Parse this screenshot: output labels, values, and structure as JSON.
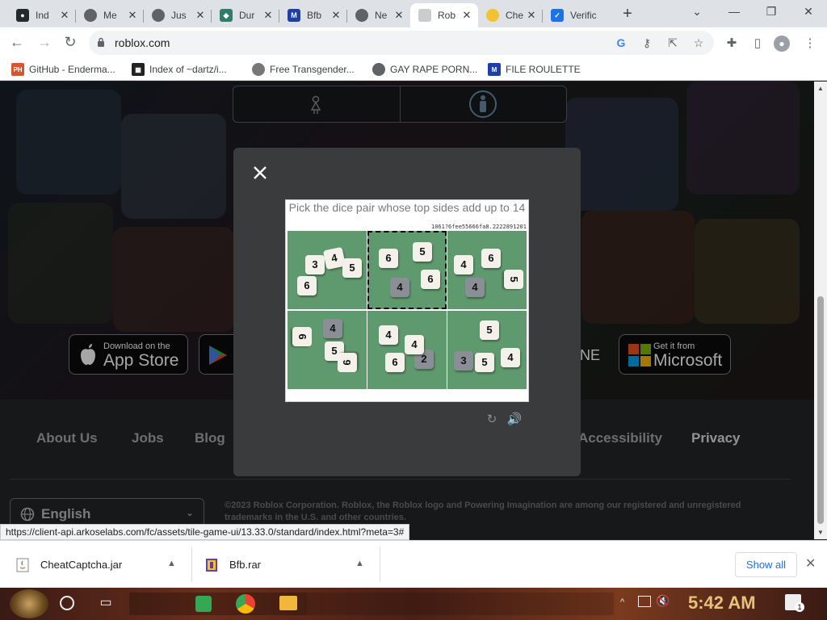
{
  "browser": {
    "tabs": [
      {
        "label": "Ind",
        "icon": "github-octocat-icon"
      },
      {
        "label": "Me",
        "icon": "chrome-icon"
      },
      {
        "label": "Jus",
        "icon": "chrome-icon"
      },
      {
        "label": "Dur",
        "icon": "cube-icon"
      },
      {
        "label": "Bfb",
        "icon": "mft-icon"
      },
      {
        "label": "Ne",
        "icon": "chrome-icon"
      },
      {
        "label": "Rob",
        "icon": "roblox-icon"
      },
      {
        "label": "Che",
        "icon": "banana-icon"
      },
      {
        "label": "Verific",
        "icon": "verification-icon"
      }
    ],
    "url": "roblox.com",
    "bookmarks": [
      {
        "label": "GitHub - Enderma...",
        "icon": "ph-icon"
      },
      {
        "label": "Index of ~dartz/i...",
        "icon": "pixel-icon"
      },
      {
        "label": "Free Transgender...",
        "icon": "mask-icon"
      },
      {
        "label": "GAY RAPE PORN...",
        "icon": "globe-icon"
      },
      {
        "label": "FILE ROULETTE",
        "icon": "mft-icon"
      }
    ]
  },
  "page": {
    "store_badges": [
      {
        "small": "Download on the",
        "big": "App Store"
      },
      {
        "small": "Get it from",
        "big": "Microsoft"
      }
    ],
    "store_partial_text": "NE",
    "footer_links": [
      "About Us",
      "Jobs",
      "Blog",
      "Accessibility",
      "Privacy"
    ],
    "language": "English",
    "copyright": "©2023 Roblox Corporation. Roblox, the Roblox logo and Powering Imagination are among our registered and unregistered trademarks in the U.S. and other countries."
  },
  "captcha": {
    "prompt": "Pick the dice pair whose top sides add up to 14",
    "meta": "1061?6fee55666fa8.2222891201",
    "tiles": [
      {
        "dice": [
          "3",
          "4",
          "6",
          "5"
        ],
        "selected": false
      },
      {
        "dice": [
          "6",
          "5",
          "6",
          "4"
        ],
        "selected": true
      },
      {
        "dice": [
          "4",
          "6",
          "5",
          "4"
        ],
        "selected": false
      },
      {
        "dice": [
          "6",
          "5",
          "6",
          "4"
        ],
        "selected": false
      },
      {
        "dice": [
          "4",
          "6",
          "2",
          "4"
        ],
        "selected": false
      },
      {
        "dice": [
          "5",
          "3",
          "5",
          "4"
        ],
        "selected": false
      }
    ]
  },
  "status_bar": {
    "url": "https://client-api.arkoselabs.com/fc/assets/tile-game-ui/13.33.0/standard/index.html?meta=3#"
  },
  "downloads": {
    "items": [
      {
        "name": "CheatCaptcha.jar"
      },
      {
        "name": "Bfb.rar"
      }
    ],
    "show_all": "Show all"
  },
  "taskbar": {
    "time": "5:42 AM",
    "notification_count": "1"
  },
  "colors": {
    "accent_link": "#1a73e8",
    "clock": "#e6c37a",
    "captcha_felt": "#5f9a6e"
  }
}
